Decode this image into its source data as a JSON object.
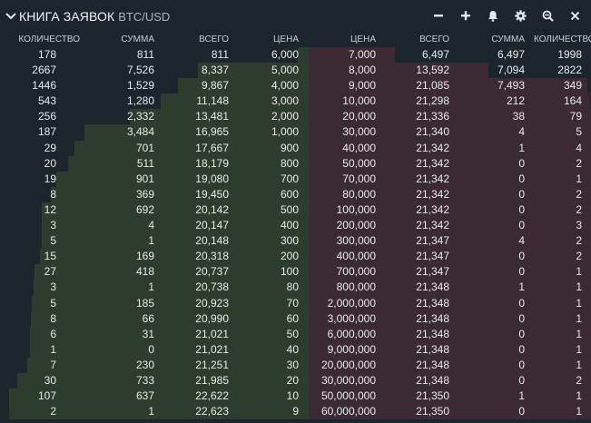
{
  "header": {
    "title": "КНИГА ЗАЯВОК",
    "subtitle": "BTC/USD",
    "tools": [
      {
        "name": "minimize-icon"
      },
      {
        "name": "plus-icon"
      },
      {
        "name": "bell-icon"
      },
      {
        "name": "gear-icon"
      },
      {
        "name": "zoom-out-icon"
      },
      {
        "name": "close-icon"
      }
    ]
  },
  "columns": [
    "КОЛИЧЕСТВО",
    "СУММА",
    "ВСЕГО",
    "ЦЕНА",
    "ЦЕНА",
    "ВСЕГО",
    "СУММА",
    "КОЛИЧЕСТВО"
  ],
  "colors": {
    "background": "#1b262c",
    "bid_bar": "#2d3d2d",
    "ask_bar": "#3b2a31"
  },
  "bids": [
    {
      "qty": "178",
      "sum": "811",
      "total": "811",
      "price": "6,000"
    },
    {
      "qty": "2667",
      "sum": "7,526",
      "total": "8,337",
      "price": "5,000"
    },
    {
      "qty": "1446",
      "sum": "1,529",
      "total": "9,867",
      "price": "4,000"
    },
    {
      "qty": "543",
      "sum": "1,280",
      "total": "11,148",
      "price": "3,000"
    },
    {
      "qty": "256",
      "sum": "2,332",
      "total": "13,481",
      "price": "2,000"
    },
    {
      "qty": "187",
      "sum": "3,484",
      "total": "16,965",
      "price": "1,000"
    },
    {
      "qty": "29",
      "sum": "701",
      "total": "17,667",
      "price": "900"
    },
    {
      "qty": "20",
      "sum": "511",
      "total": "18,179",
      "price": "800"
    },
    {
      "qty": "19",
      "sum": "901",
      "total": "19,080",
      "price": "700"
    },
    {
      "qty": "8",
      "sum": "369",
      "total": "19,450",
      "price": "600"
    },
    {
      "qty": "12",
      "sum": "692",
      "total": "20,142",
      "price": "500"
    },
    {
      "qty": "3",
      "sum": "4",
      "total": "20,147",
      "price": "400"
    },
    {
      "qty": "5",
      "sum": "1",
      "total": "20,148",
      "price": "300"
    },
    {
      "qty": "15",
      "sum": "169",
      "total": "20,318",
      "price": "200"
    },
    {
      "qty": "27",
      "sum": "418",
      "total": "20,737",
      "price": "100"
    },
    {
      "qty": "3",
      "sum": "1",
      "total": "20,738",
      "price": "80"
    },
    {
      "qty": "5",
      "sum": "185",
      "total": "20,923",
      "price": "70"
    },
    {
      "qty": "8",
      "sum": "66",
      "total": "20,990",
      "price": "60"
    },
    {
      "qty": "6",
      "sum": "31",
      "total": "21,021",
      "price": "50"
    },
    {
      "qty": "1",
      "sum": "0",
      "total": "21,021",
      "price": "40"
    },
    {
      "qty": "7",
      "sum": "230",
      "total": "21,251",
      "price": "30"
    },
    {
      "qty": "30",
      "sum": "733",
      "total": "21,985",
      "price": "20"
    },
    {
      "qty": "107",
      "sum": "637",
      "total": "22,622",
      "price": "10"
    },
    {
      "qty": "2",
      "sum": "1",
      "total": "22,623",
      "price": "9"
    }
  ],
  "asks": [
    {
      "price": "7,000",
      "total": "6,497",
      "sum": "6,497",
      "qty": "1998"
    },
    {
      "price": "8,000",
      "total": "13,592",
      "sum": "7,094",
      "qty": "2822"
    },
    {
      "price": "9,000",
      "total": "21,085",
      "sum": "7,493",
      "qty": "349"
    },
    {
      "price": "10,000",
      "total": "21,298",
      "sum": "212",
      "qty": "164"
    },
    {
      "price": "20,000",
      "total": "21,336",
      "sum": "38",
      "qty": "79"
    },
    {
      "price": "30,000",
      "total": "21,340",
      "sum": "4",
      "qty": "5"
    },
    {
      "price": "40,000",
      "total": "21,342",
      "sum": "1",
      "qty": "4"
    },
    {
      "price": "50,000",
      "total": "21,342",
      "sum": "0",
      "qty": "2"
    },
    {
      "price": "70,000",
      "total": "21,342",
      "sum": "0",
      "qty": "1"
    },
    {
      "price": "80,000",
      "total": "21,342",
      "sum": "0",
      "qty": "2"
    },
    {
      "price": "100,000",
      "total": "21,342",
      "sum": "0",
      "qty": "2"
    },
    {
      "price": "200,000",
      "total": "21,342",
      "sum": "0",
      "qty": "3"
    },
    {
      "price": "300,000",
      "total": "21,347",
      "sum": "4",
      "qty": "2"
    },
    {
      "price": "400,000",
      "total": "21,347",
      "sum": "0",
      "qty": "2"
    },
    {
      "price": "700,000",
      "total": "21,347",
      "sum": "0",
      "qty": "1"
    },
    {
      "price": "800,000",
      "total": "21,348",
      "sum": "1",
      "qty": "1"
    },
    {
      "price": "2,000,000",
      "total": "21,348",
      "sum": "0",
      "qty": "1"
    },
    {
      "price": "3,000,000",
      "total": "21,348",
      "sum": "0",
      "qty": "1"
    },
    {
      "price": "6,000,000",
      "total": "21,348",
      "sum": "0",
      "qty": "1"
    },
    {
      "price": "9,000,000",
      "total": "21,348",
      "sum": "0",
      "qty": "1"
    },
    {
      "price": "20,000,000",
      "total": "21,348",
      "sum": "0",
      "qty": "1"
    },
    {
      "price": "30,000,000",
      "total": "21,348",
      "sum": "0",
      "qty": "2"
    },
    {
      "price": "50,000,000",
      "total": "21,350",
      "sum": "1",
      "qty": "1"
    },
    {
      "price": "60,000,000",
      "total": "21,350",
      "sum": "0",
      "qty": "1"
    }
  ]
}
